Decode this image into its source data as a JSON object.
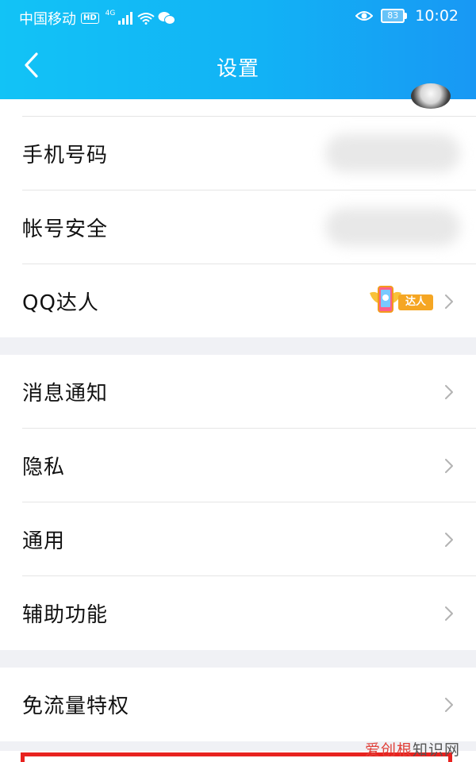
{
  "status_bar": {
    "carrier": "中国移动",
    "hd": "HD",
    "network": "4G",
    "battery": "83",
    "time": "10:02",
    "icons": [
      "signal-icon",
      "wifi-icon",
      "wechat-icon",
      "eye-icon",
      "battery-icon"
    ]
  },
  "header": {
    "title": "设置",
    "back_icon": "chevron-left-icon",
    "gradient": [
      "#12c3f6",
      "#1898f4"
    ]
  },
  "group1": [
    {
      "label": "手机号码",
      "value_obscured": true
    },
    {
      "label": "帐号安全",
      "value_obscured": true
    },
    {
      "label": "QQ达人",
      "badge": "达人"
    }
  ],
  "group2": [
    {
      "label": "消息通知"
    },
    {
      "label": "隐私"
    },
    {
      "label": "通用"
    },
    {
      "label": "辅助功能"
    }
  ],
  "group3": [
    {
      "label": "免流量特权"
    }
  ],
  "watermark": {
    "part1": "爱创根",
    "part2": "知识网"
  },
  "colors": {
    "highlight": "#e8221f",
    "badge": "#f5a623",
    "chevron": "#b3b3b3"
  }
}
